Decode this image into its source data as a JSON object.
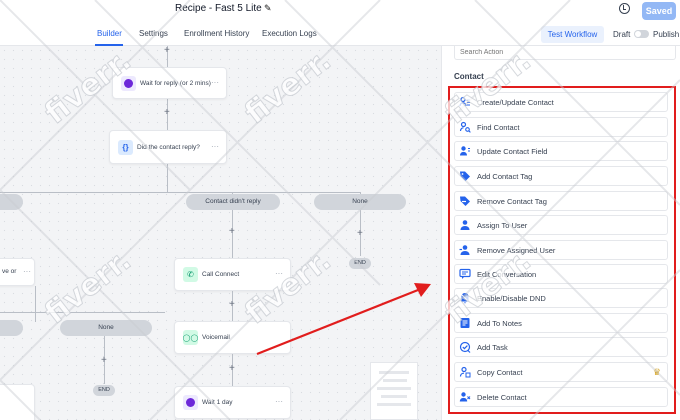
{
  "header": {
    "workflow_title": "Recipe - Fast 5 Lite",
    "saved_label": "Saved"
  },
  "tabs": [
    {
      "label": "Builder",
      "active": true
    },
    {
      "label": "Settings"
    },
    {
      "label": "Enrollment History"
    },
    {
      "label": "Execution Logs"
    }
  ],
  "toolbar": {
    "test_label": "Test Workflow",
    "draft_label": "Draft",
    "publish_label": "Publish",
    "published": false
  },
  "canvas": {
    "node_wait_reply": "Wait for reply (or 2 mins)",
    "node_condition": "Did the contact reply?",
    "branch_no_reply": "Contact didn't reply",
    "branch_none": "None",
    "node_partial": "ve or",
    "branch_none_left": "None",
    "node_call": "Call Connect",
    "node_voicemail": "Voicemail",
    "node_wait_day": "Wait 1 day",
    "end_label": "END"
  },
  "sidebar": {
    "search_placeholder": "Search Action",
    "section_title": "Contact",
    "actions": [
      {
        "label": "Create/Update Contact",
        "icon": "users-icon"
      },
      {
        "label": "Find Contact",
        "icon": "user-search-icon"
      },
      {
        "label": "Update Contact Field",
        "icon": "user-edit-icon"
      },
      {
        "label": "Add Contact Tag",
        "icon": "tag-icon"
      },
      {
        "label": "Remove Contact Tag",
        "icon": "tag-remove-icon"
      },
      {
        "label": "Assign To User",
        "icon": "user-assign-icon"
      },
      {
        "label": "Remove Assigned User",
        "icon": "user-remove-icon"
      },
      {
        "label": "Edit Conversation",
        "icon": "chat-icon"
      },
      {
        "label": "Enable/Disable DND",
        "icon": "dnd-icon"
      },
      {
        "label": "Add To Notes",
        "icon": "notes-icon"
      },
      {
        "label": "Add Task",
        "icon": "task-icon"
      },
      {
        "label": "Copy Contact",
        "icon": "copy-user-icon",
        "premium": true
      },
      {
        "label": "Delete Contact",
        "icon": "user-delete-icon"
      }
    ]
  },
  "colors": {
    "accent": "#2563eb",
    "saved_button": "#93b8f5",
    "highlight_box": "#e11d1d",
    "premium_crown": "#d39e14"
  },
  "watermark": "fiverr."
}
